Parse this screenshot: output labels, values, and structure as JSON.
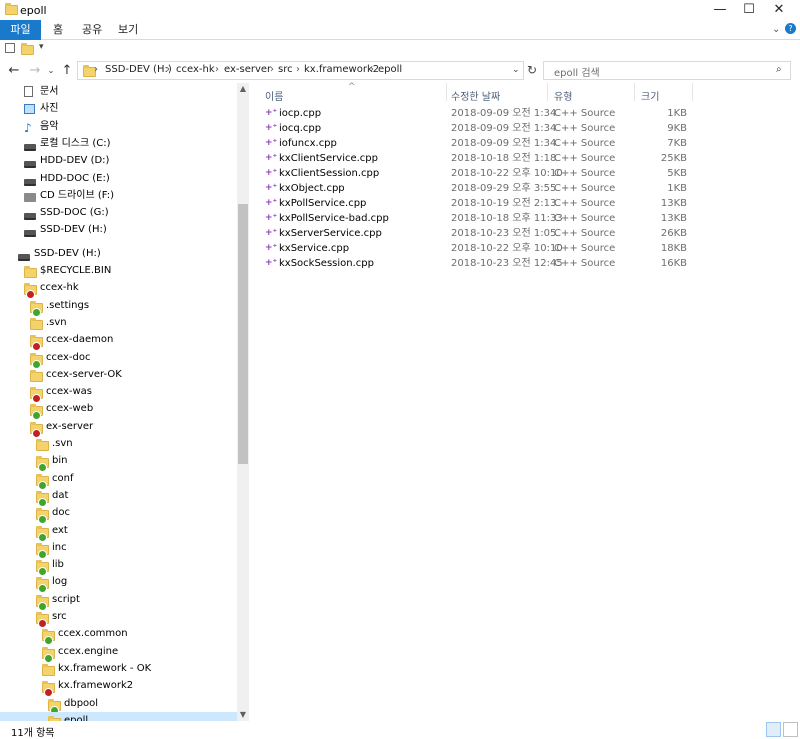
{
  "window": {
    "title": "epoll",
    "minimize": "—",
    "maximize": "☐",
    "close": "✕"
  },
  "ribbon": {
    "tabs": [
      "파일",
      "홈",
      "공유",
      "보기"
    ]
  },
  "address": {
    "crumbs": [
      "SSD-DEV (H:)",
      "ccex-hk",
      "ex-server",
      "src",
      "kx.framework2",
      "epoll"
    ]
  },
  "search": {
    "placeholder": "epoll 검색"
  },
  "nav": {
    "items": [
      {
        "label": "문서",
        "icon": "document-icon",
        "indent": 24,
        "kind": "doc"
      },
      {
        "label": "사진",
        "icon": "pictures-icon",
        "indent": 24,
        "kind": "pic"
      },
      {
        "label": "음악",
        "icon": "music-icon",
        "indent": 24,
        "kind": "note"
      },
      {
        "label": "로컬 디스크 (C:)",
        "icon": "drive-icon",
        "indent": 24,
        "kind": "drive"
      },
      {
        "label": "HDD-DEV (D:)",
        "icon": "drive-icon",
        "indent": 24,
        "kind": "drive"
      },
      {
        "label": "HDD-DOC (E:)",
        "icon": "drive-icon",
        "indent": 24,
        "kind": "drive"
      },
      {
        "label": "CD 드라이브 (F:)",
        "icon": "cd-drive-icon",
        "indent": 24,
        "kind": "cd"
      },
      {
        "label": "SSD-DOC (G:)",
        "icon": "drive-icon",
        "indent": 24,
        "kind": "drive"
      },
      {
        "label": "SSD-DEV (H:)",
        "icon": "drive-icon",
        "indent": 24,
        "kind": "drive"
      },
      {
        "label": "SSD-DEV (H:)",
        "icon": "drive-icon",
        "indent": 18,
        "kind": "drive",
        "gap": true
      },
      {
        "label": "$RECYCLE.BIN",
        "icon": "folder-icon",
        "indent": 24,
        "kind": "folder"
      },
      {
        "label": "ccex-hk",
        "icon": "folder-icon",
        "indent": 24,
        "kind": "folder",
        "badge": "warn"
      },
      {
        "label": ".settings",
        "icon": "folder-icon",
        "indent": 30,
        "kind": "folder",
        "badge": "ok"
      },
      {
        "label": ".svn",
        "icon": "folder-icon",
        "indent": 30,
        "kind": "folder"
      },
      {
        "label": "ccex-daemon",
        "icon": "folder-icon",
        "indent": 30,
        "kind": "folder",
        "badge": "warn"
      },
      {
        "label": "ccex-doc",
        "icon": "folder-icon",
        "indent": 30,
        "kind": "folder",
        "badge": "ok"
      },
      {
        "label": "ccex-server-OK",
        "icon": "folder-icon",
        "indent": 30,
        "kind": "folder"
      },
      {
        "label": "ccex-was",
        "icon": "folder-icon",
        "indent": 30,
        "kind": "folder",
        "badge": "warn"
      },
      {
        "label": "ccex-web",
        "icon": "folder-icon",
        "indent": 30,
        "kind": "folder",
        "badge": "ok"
      },
      {
        "label": "ex-server",
        "icon": "folder-icon",
        "indent": 30,
        "kind": "folder",
        "badge": "warn"
      },
      {
        "label": ".svn",
        "icon": "folder-icon",
        "indent": 36,
        "kind": "folder"
      },
      {
        "label": "bin",
        "icon": "folder-icon",
        "indent": 36,
        "kind": "folder",
        "badge": "ok"
      },
      {
        "label": "conf",
        "icon": "folder-icon",
        "indent": 36,
        "kind": "folder",
        "badge": "ok"
      },
      {
        "label": "dat",
        "icon": "folder-icon",
        "indent": 36,
        "kind": "folder",
        "badge": "ok"
      },
      {
        "label": "doc",
        "icon": "folder-icon",
        "indent": 36,
        "kind": "folder",
        "badge": "ok"
      },
      {
        "label": "ext",
        "icon": "folder-icon",
        "indent": 36,
        "kind": "folder",
        "badge": "ok"
      },
      {
        "label": "inc",
        "icon": "folder-icon",
        "indent": 36,
        "kind": "folder",
        "badge": "ok"
      },
      {
        "label": "lib",
        "icon": "folder-icon",
        "indent": 36,
        "kind": "folder",
        "badge": "ok"
      },
      {
        "label": "log",
        "icon": "folder-icon",
        "indent": 36,
        "kind": "folder",
        "badge": "ok"
      },
      {
        "label": "script",
        "icon": "folder-icon",
        "indent": 36,
        "kind": "folder",
        "badge": "ok"
      },
      {
        "label": "src",
        "icon": "folder-icon",
        "indent": 36,
        "kind": "folder",
        "badge": "warn"
      },
      {
        "label": "ccex.common",
        "icon": "folder-icon",
        "indent": 42,
        "kind": "folder",
        "badge": "ok"
      },
      {
        "label": "ccex.engine",
        "icon": "folder-icon",
        "indent": 42,
        "kind": "folder",
        "badge": "ok"
      },
      {
        "label": "kx.framework - OK",
        "icon": "folder-icon",
        "indent": 42,
        "kind": "folder"
      },
      {
        "label": "kx.framework2",
        "icon": "folder-icon",
        "indent": 42,
        "kind": "folder",
        "badge": "warn"
      },
      {
        "label": "dbpool",
        "icon": "folder-icon",
        "indent": 48,
        "kind": "folder",
        "badge": "ok"
      },
      {
        "label": "epoll",
        "icon": "folder-icon",
        "indent": 48,
        "kind": "folder",
        "badge": "ok",
        "selected": true
      }
    ]
  },
  "columns": [
    "이름",
    "수정한 날짜",
    "유형",
    "크기"
  ],
  "files": [
    {
      "name": "iocp.cpp",
      "date": "2018-09-09 오전 1:34",
      "type": "C++ Source",
      "size": "1KB"
    },
    {
      "name": "iocq.cpp",
      "date": "2018-09-09 오전 1:34",
      "type": "C++ Source",
      "size": "9KB"
    },
    {
      "name": "iofuncx.cpp",
      "date": "2018-09-09 오전 1:34",
      "type": "C++ Source",
      "size": "7KB"
    },
    {
      "name": "kxClientService.cpp",
      "date": "2018-10-18 오전 1:18",
      "type": "C++ Source",
      "size": "25KB"
    },
    {
      "name": "kxClientSession.cpp",
      "date": "2018-10-22 오후 10:10",
      "type": "C++ Source",
      "size": "5KB"
    },
    {
      "name": "kxObject.cpp",
      "date": "2018-09-29 오후 3:55",
      "type": "C++ Source",
      "size": "1KB"
    },
    {
      "name": "kxPollService.cpp",
      "date": "2018-10-19 오전 2:13",
      "type": "C++ Source",
      "size": "13KB"
    },
    {
      "name": "kxPollService-bad.cpp",
      "date": "2018-10-18 오후 11:33",
      "type": "C++ Source",
      "size": "13KB"
    },
    {
      "name": "kxServerService.cpp",
      "date": "2018-10-23 오전 1:05",
      "type": "C++ Source",
      "size": "26KB"
    },
    {
      "name": "kxService.cpp",
      "date": "2018-10-22 오후 10:10",
      "type": "C++ Source",
      "size": "18KB"
    },
    {
      "name": "kxSockSession.cpp",
      "date": "2018-10-23 오전 12:45",
      "type": "C++ Source",
      "size": "16KB"
    }
  ],
  "status": {
    "count": "11개 항목"
  },
  "colors": {
    "accent": "#1979ca",
    "selection": "#cce8ff",
    "ok": "#3fa52c",
    "warn": "#c02222"
  }
}
